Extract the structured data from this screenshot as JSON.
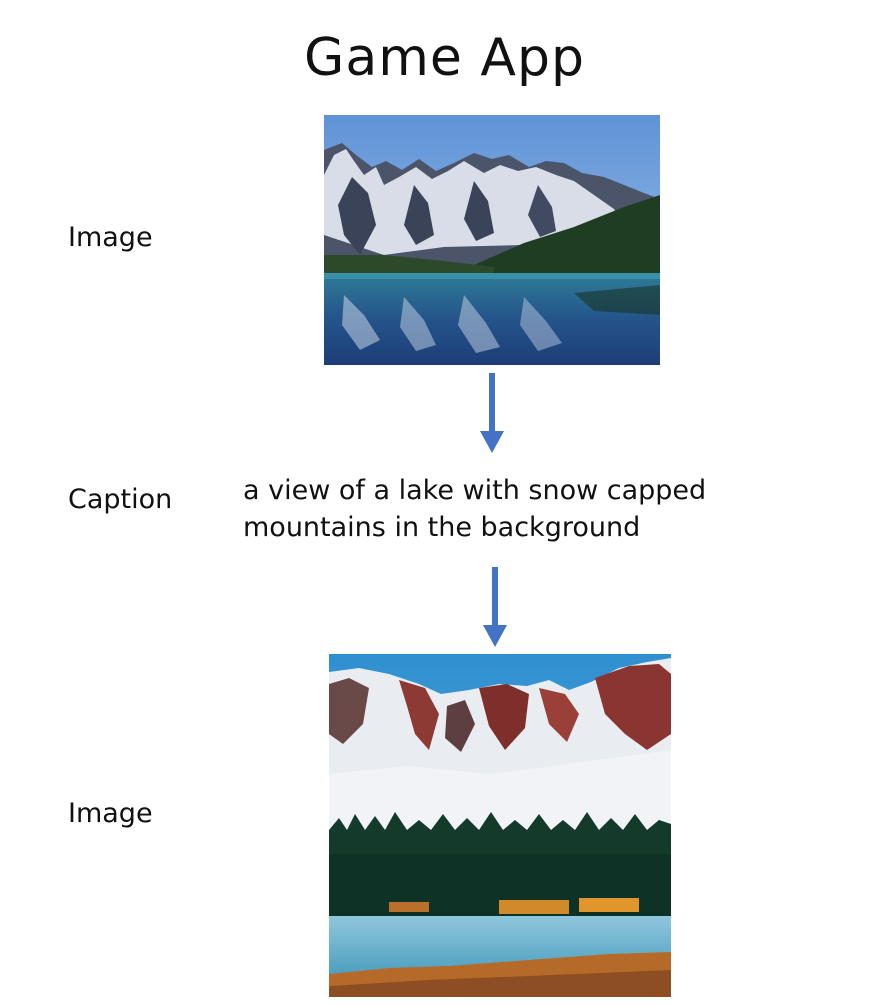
{
  "title": "Game App",
  "steps": [
    {
      "label": "Image"
    },
    {
      "label": "Caption",
      "text": "a view of a lake with snow capped mountains in the background"
    },
    {
      "label": "Image"
    }
  ],
  "colors": {
    "arrow": "#4472c4",
    "text": "#111111",
    "background": "#ffffff"
  }
}
